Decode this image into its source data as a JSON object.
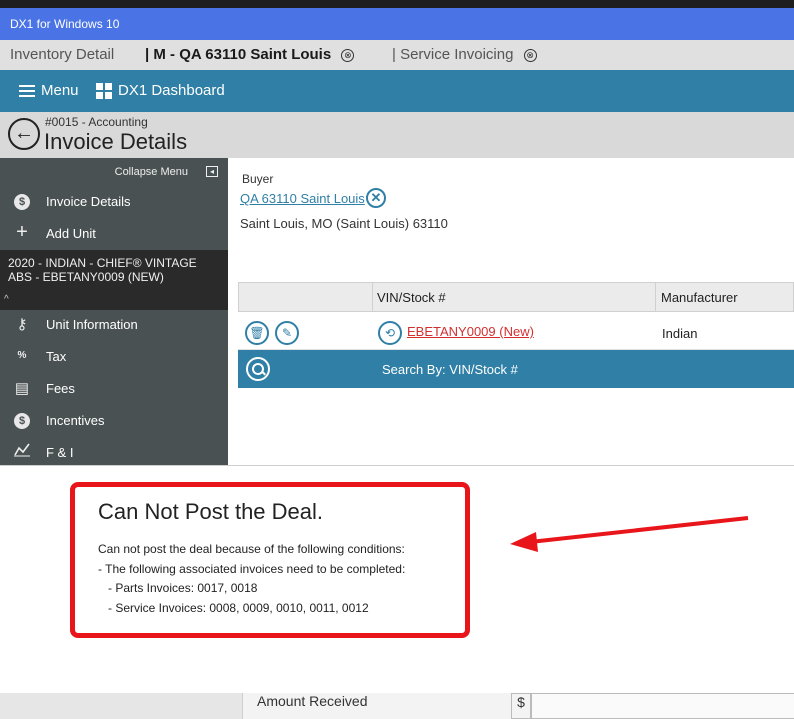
{
  "app": {
    "title": "DX1 for Windows 10"
  },
  "tabs": [
    {
      "label": "Inventory Detail"
    },
    {
      "label": "| M - QA 63110 Saint Louis",
      "close": "⊗"
    },
    {
      "label": "| Service Invoicing",
      "close": "⊗"
    }
  ],
  "nav": {
    "menu_label": "Menu",
    "dashboard_label": "DX1 Dashboard"
  },
  "page": {
    "breadcrumb": "#0015 - Accounting",
    "title": "Invoice Details",
    "back_icon": "arrow-left-icon"
  },
  "sidebar": {
    "collapse_label": "Collapse Menu",
    "items": [
      {
        "label": "Invoice Details",
        "icon": "dollar-circle-icon"
      },
      {
        "label": "Add Unit",
        "icon": "plus-icon"
      },
      {
        "label": "Unit Information",
        "icon": "key-icon"
      },
      {
        "label": "Tax",
        "icon": "tax-icon"
      },
      {
        "label": "Fees",
        "icon": "document-icon"
      },
      {
        "label": "Incentives",
        "icon": "dollar-circle-icon"
      },
      {
        "label": "F & I",
        "icon": "chart-icon"
      }
    ],
    "unit": {
      "line1": "2020 - INDIAN - CHIEF® VINTAGE",
      "line2": "ABS - EBETANY0009 (NEW)"
    }
  },
  "buyer": {
    "label": "Buyer",
    "name": "QA 63110 Saint Louis",
    "address": "Saint Louis, MO (Saint Louis) 63110"
  },
  "units_table": {
    "columns": [
      "",
      "VIN/Stock #",
      "Manufacturer"
    ],
    "rows": [
      {
        "vin": "EBETANY0009 (New)",
        "manufacturer": "Indian"
      }
    ],
    "search_label": "Search By: VIN/Stock #"
  },
  "dialog": {
    "title": "Can Not Post the Deal.",
    "line1": "Can not post the deal because of the following conditions:",
    "line2": "- The following associated invoices need to be completed:",
    "line3": "- Parts Invoices: 0017, 0018",
    "line4": "- Service Invoices: 0008, 0009, 0010, 0011, 0012"
  },
  "footer": {
    "amount_received_label": "Amount Received",
    "currency_symbol": "$",
    "amount_value": ""
  },
  "colors": {
    "title_bar": "#4a74e6",
    "nav_bar": "#2f7fa6",
    "sidebar": "#4a5152",
    "annotation_red": "#e8161b",
    "vin_link": "#d32f2f"
  }
}
